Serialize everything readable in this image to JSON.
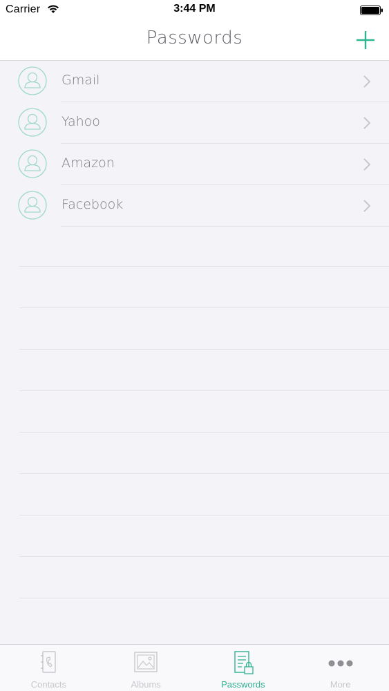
{
  "status_bar": {
    "carrier": "Carrier",
    "time": "3:44 PM"
  },
  "nav": {
    "title": "Passwords",
    "add_icon": "plus-icon"
  },
  "colors": {
    "accent": "#2fb390",
    "avatar_stroke": "#9ed9c6",
    "text": "#7a7a80",
    "background": "#f4f3f7"
  },
  "passwords": [
    {
      "label": "Gmail",
      "icon": "person-icon"
    },
    {
      "label": "Yahoo",
      "icon": "person-icon"
    },
    {
      "label": "Amazon",
      "icon": "person-icon"
    },
    {
      "label": "Facebook",
      "icon": "person-icon"
    }
  ],
  "tabs": [
    {
      "label": "Contacts",
      "icon": "contacts-icon",
      "active": false
    },
    {
      "label": "Albums",
      "icon": "albums-icon",
      "active": false
    },
    {
      "label": "Passwords",
      "icon": "passwords-icon",
      "active": true
    },
    {
      "label": "More",
      "icon": "more-icon",
      "active": false
    }
  ]
}
